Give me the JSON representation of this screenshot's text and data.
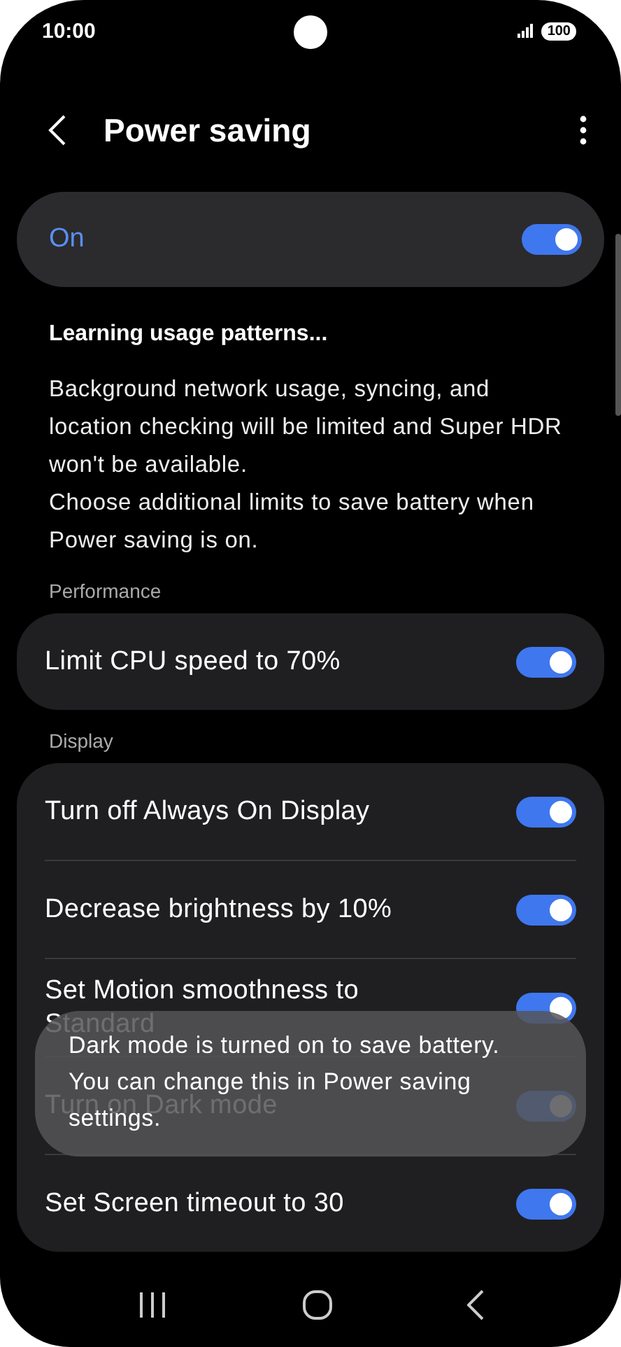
{
  "status_bar": {
    "time": "10:00",
    "battery": "100"
  },
  "header": {
    "title": "Power saving"
  },
  "master": {
    "label": "On",
    "on": true
  },
  "status_text": "Learning usage patterns...",
  "description": [
    "Background network usage, syncing, and location checking will be limited and Super HDR won't be available.",
    "Choose additional limits to save battery when Power saving is on."
  ],
  "sections": [
    {
      "title": "Performance",
      "items": [
        {
          "label": "Limit CPU speed to 70%",
          "on": true
        }
      ]
    },
    {
      "title": "Display",
      "items": [
        {
          "label": "Turn off Always On Display",
          "on": true
        },
        {
          "label": "Decrease brightness by 10%",
          "on": true
        },
        {
          "label": "Set Motion smoothness to Standard",
          "on": true
        },
        {
          "label": "Turn on Dark mode",
          "on": true
        },
        {
          "label": "Set Screen timeout to 30",
          "on": true
        }
      ]
    }
  ],
  "toast": "Dark mode is turned on to save battery. You can change this in Power saving settings."
}
